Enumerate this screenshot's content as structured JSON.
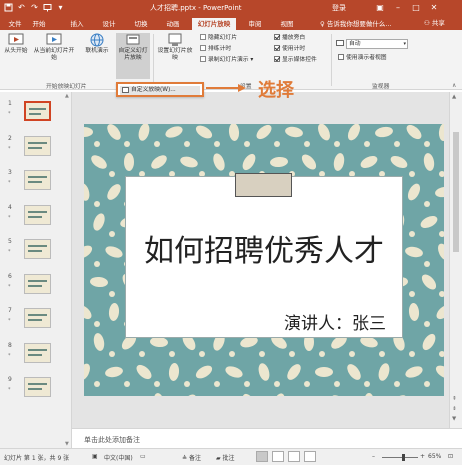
{
  "window": {
    "title": "人才招聘.pptx - PowerPoint",
    "login": "登录",
    "brand_color": "#b7472a"
  },
  "tabs": [
    {
      "label": "文件"
    },
    {
      "label": "开始"
    },
    {
      "label": "插入"
    },
    {
      "label": "设计"
    },
    {
      "label": "切换"
    },
    {
      "label": "动画"
    },
    {
      "label": "幻灯片放映",
      "active": true
    },
    {
      "label": "审阅"
    },
    {
      "label": "视图"
    }
  ],
  "tell_me": "告诉我你想要做什么...",
  "share": "共享",
  "ribbon": {
    "start_group": {
      "from_beginning": "从头开始",
      "from_current": "从当前幻灯片开始",
      "online": "联机演示",
      "custom": "自定义幻灯片放映",
      "label": "开始放映幻灯片"
    },
    "setup_group": {
      "setup": "设置幻灯片放映",
      "hide_slide": "隐藏幻灯片",
      "rehearse": "排练计时",
      "record": "录制幻灯片演示",
      "label": "设置",
      "play_narrations": "播放旁白",
      "use_timings": "使用计时",
      "show_media_controls": "显示媒体控件"
    },
    "monitors_group": {
      "monitor_value": "自动",
      "presenter_view": "使用演示者视图",
      "label": "监视器"
    }
  },
  "dropdown": {
    "item": "自定义放映(W)..."
  },
  "annotation": {
    "text": "选择",
    "color": "#e07b39"
  },
  "thumbnails": [
    {
      "num": "1",
      "selected": true
    },
    {
      "num": "2"
    },
    {
      "num": "3"
    },
    {
      "num": "4"
    },
    {
      "num": "5"
    },
    {
      "num": "6"
    },
    {
      "num": "7"
    },
    {
      "num": "8"
    },
    {
      "num": "9"
    }
  ],
  "slide": {
    "title": "如何招聘优秀人才",
    "subtitle": "演讲人：张三",
    "bg_color": "#6fa5a6",
    "leaf_color": "#ece6cf"
  },
  "notes": {
    "placeholder": "单击此处添加备注"
  },
  "status": {
    "slide_info": "幻灯片 第 1 张，共 9 张",
    "language": "中文(中国)",
    "notes_btn": "备注",
    "comments_btn": "批注",
    "zoom": "65%"
  }
}
